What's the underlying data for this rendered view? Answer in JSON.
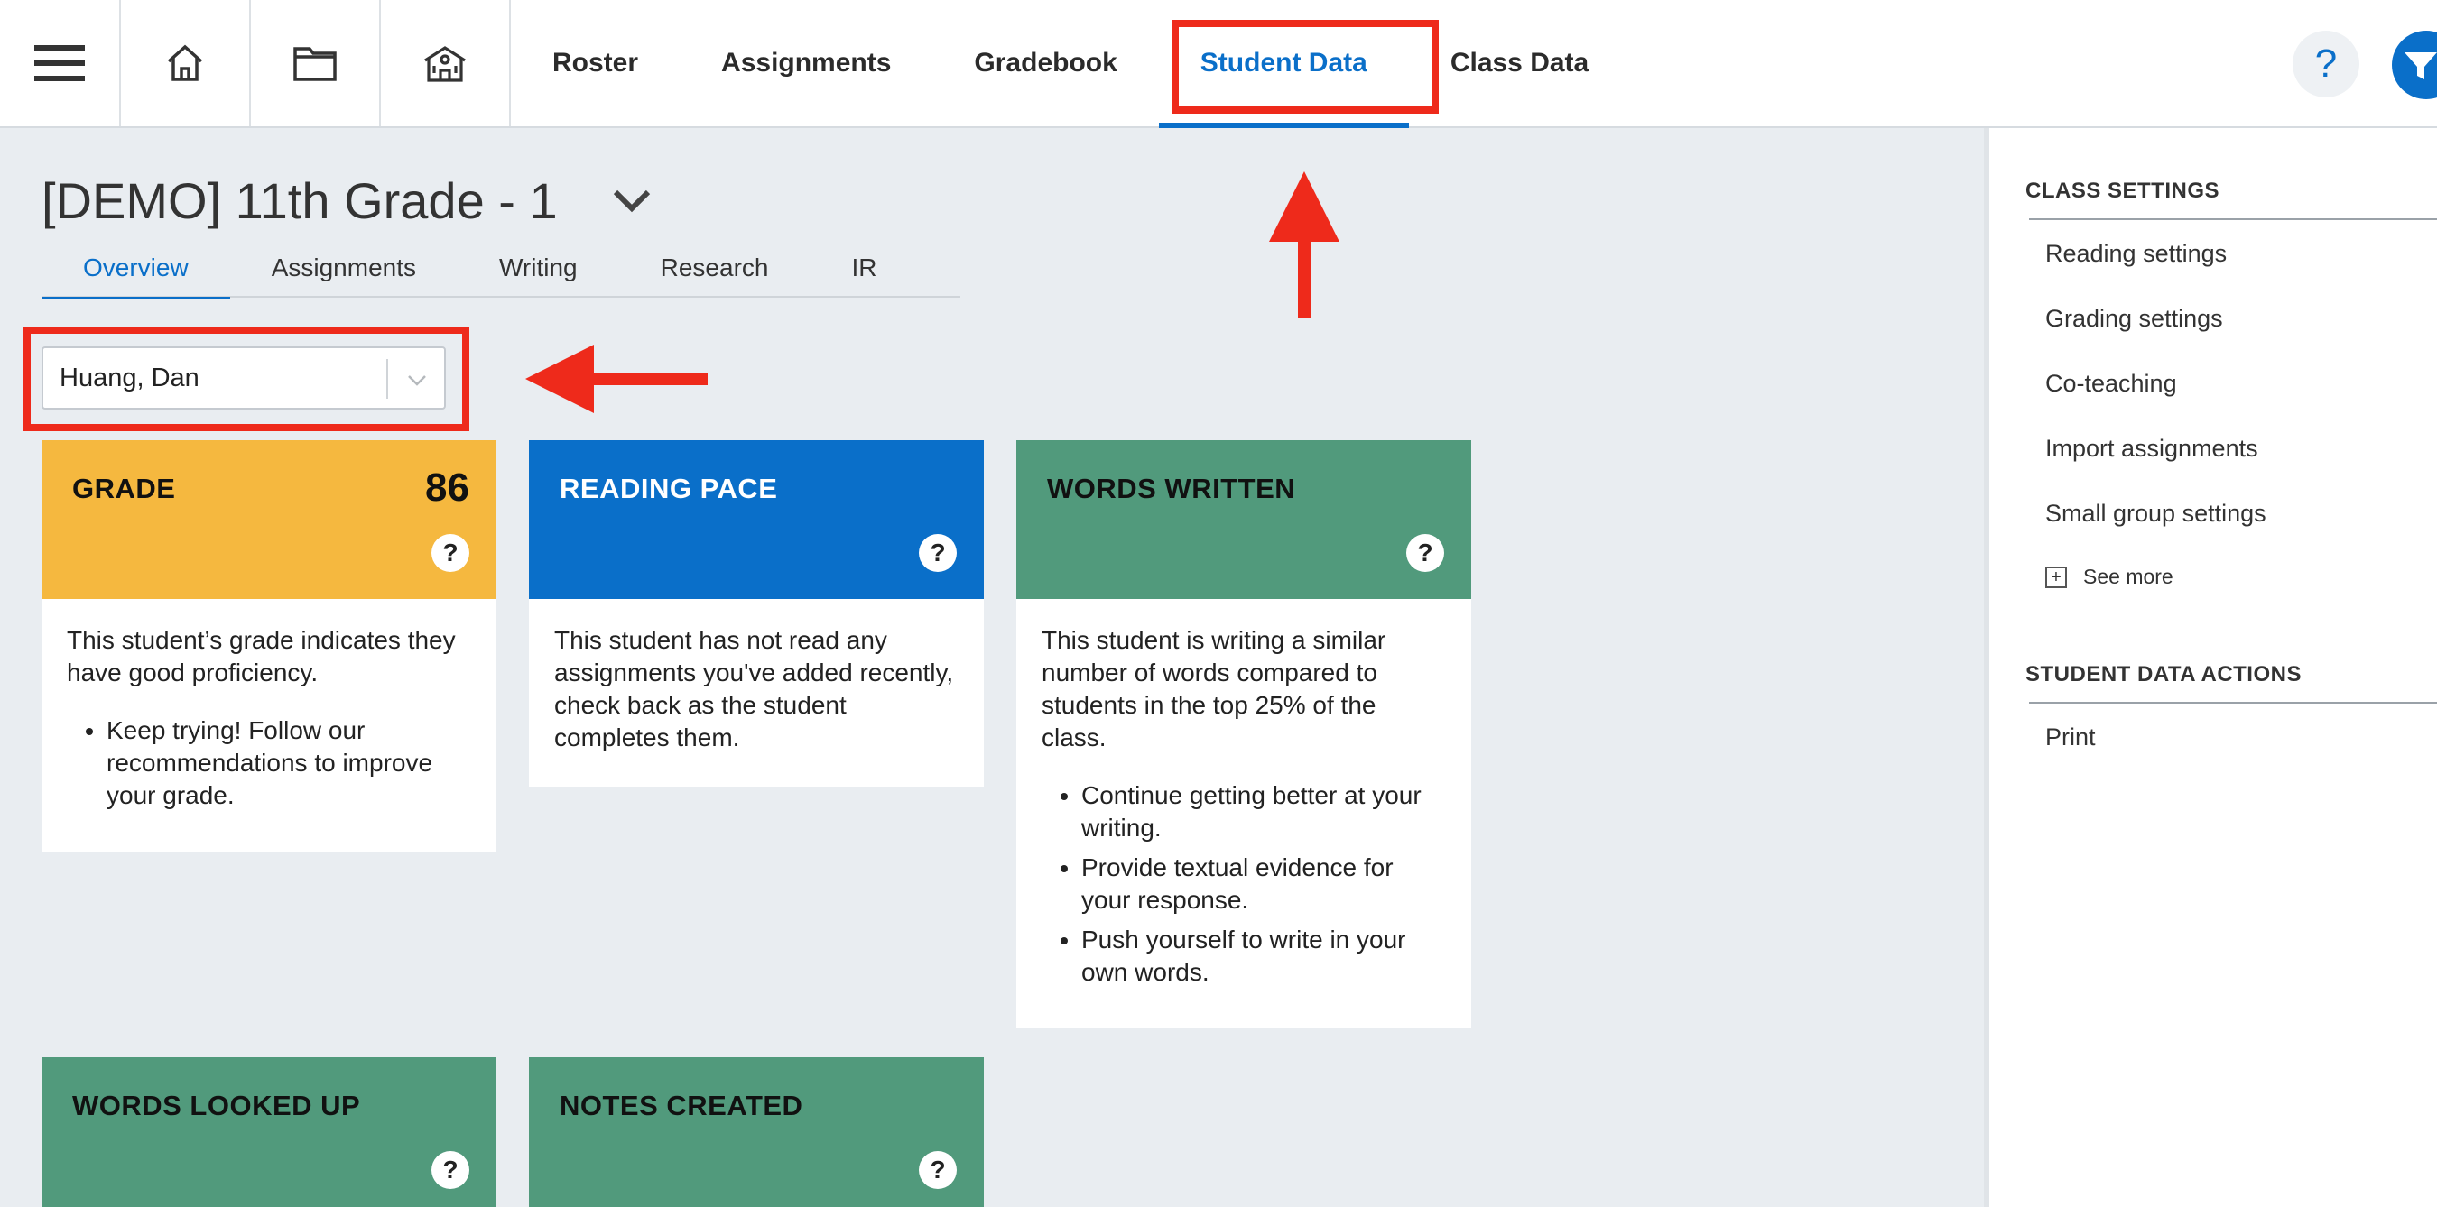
{
  "topbar": {
    "icons": [
      "menu-icon",
      "home-icon",
      "folder-icon",
      "school-icon"
    ],
    "nav": [
      {
        "label": "Roster",
        "active": false
      },
      {
        "label": "Assignments",
        "active": false
      },
      {
        "label": "Gradebook",
        "active": false
      },
      {
        "label": "Student Data",
        "active": true
      },
      {
        "label": "Class Data",
        "active": false
      }
    ],
    "help_label": "?"
  },
  "main": {
    "class_title": "[DEMO] 11th Grade - 1",
    "subtabs": [
      {
        "label": "Overview",
        "active": true
      },
      {
        "label": "Assignments",
        "active": false
      },
      {
        "label": "Writing",
        "active": false
      },
      {
        "label": "Research",
        "active": false
      },
      {
        "label": "IR",
        "active": false
      }
    ],
    "student_select": {
      "value": "Huang, Dan"
    },
    "cards": {
      "grade": {
        "label": "GRADE",
        "value": "86",
        "text": "This student’s grade indicates they have good proficiency.",
        "bullets": [
          "Keep trying! Follow our recommendations to improve your grade."
        ]
      },
      "reading_pace": {
        "label": "READING PACE",
        "text": "This student has not read any assignments you've added recently, check back as the student completes them."
      },
      "words_written": {
        "label": "WORDS WRITTEN",
        "text": "This student is writing a similar number of words compared to students in the top 25% of the class.",
        "bullets": [
          "Continue getting better at your writing.",
          "Provide textual evidence for your response.",
          "Push yourself to write in your own words."
        ]
      },
      "words_looked_up": {
        "label": "WORDS LOOKED UP"
      },
      "notes_created": {
        "label": "NOTES CREATED"
      }
    },
    "qmark": "?"
  },
  "right_panel": {
    "class_settings_title": "CLASS SETTINGS",
    "class_settings_links": [
      "Reading settings",
      "Grading settings",
      "Co-teaching",
      "Import assignments",
      "Small group settings"
    ],
    "see_more": "See more",
    "student_actions_title": "STUDENT DATA ACTIONS",
    "student_actions_links": [
      "Print"
    ]
  },
  "colors": {
    "accent": "#0a6fc9",
    "grade_card": "#f5b83f",
    "reading_card": "#0a6fc9",
    "green_card": "#519a7c",
    "annotation": "#ee2a1b"
  }
}
